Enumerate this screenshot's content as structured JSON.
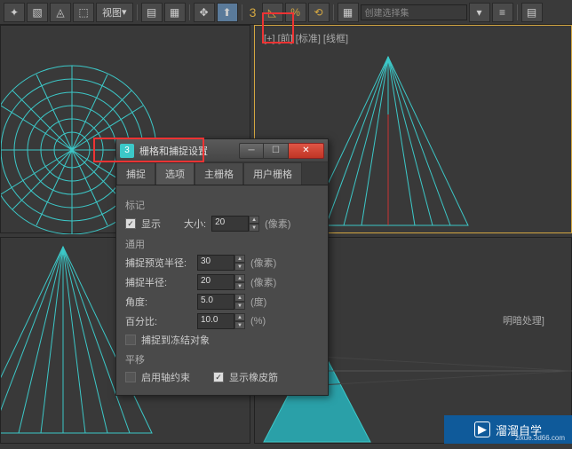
{
  "toolbar": {
    "view_label": "视图",
    "three": "3",
    "create_selection_set": "创建选择集"
  },
  "viewports": {
    "tr_label": "[+] [前] [标准] [线框]",
    "br_label": "明暗处理]"
  },
  "dialog": {
    "title_icon": "3",
    "title": "栅格和捕捉设置",
    "tabs": [
      "捕捉",
      "选项",
      "主栅格",
      "用户栅格"
    ],
    "active_tab": 1,
    "groups": {
      "marker_label": "标记",
      "display_label": "显示",
      "size_label": "大小:",
      "size_value": "20",
      "size_unit": "(像素)",
      "general_label": "通用",
      "preview_radius_label": "捕捉预览半径:",
      "preview_radius_value": "30",
      "preview_radius_unit": "(像素)",
      "snap_radius_label": "捕捉半径:",
      "snap_radius_value": "20",
      "snap_radius_unit": "(像素)",
      "angle_label": "角度:",
      "angle_value": "5.0",
      "angle_unit": "(度)",
      "percent_label": "百分比:",
      "percent_value": "10.0",
      "percent_unit": "(%)",
      "snap_frozen_label": "捕捉到冻结对象",
      "translation_label": "平移",
      "use_axis_label": "启用轴约束",
      "rubber_band_label": "显示橡皮筋"
    }
  },
  "watermark": {
    "text": "溜溜自学",
    "sub": "zixue.3d66.com"
  }
}
